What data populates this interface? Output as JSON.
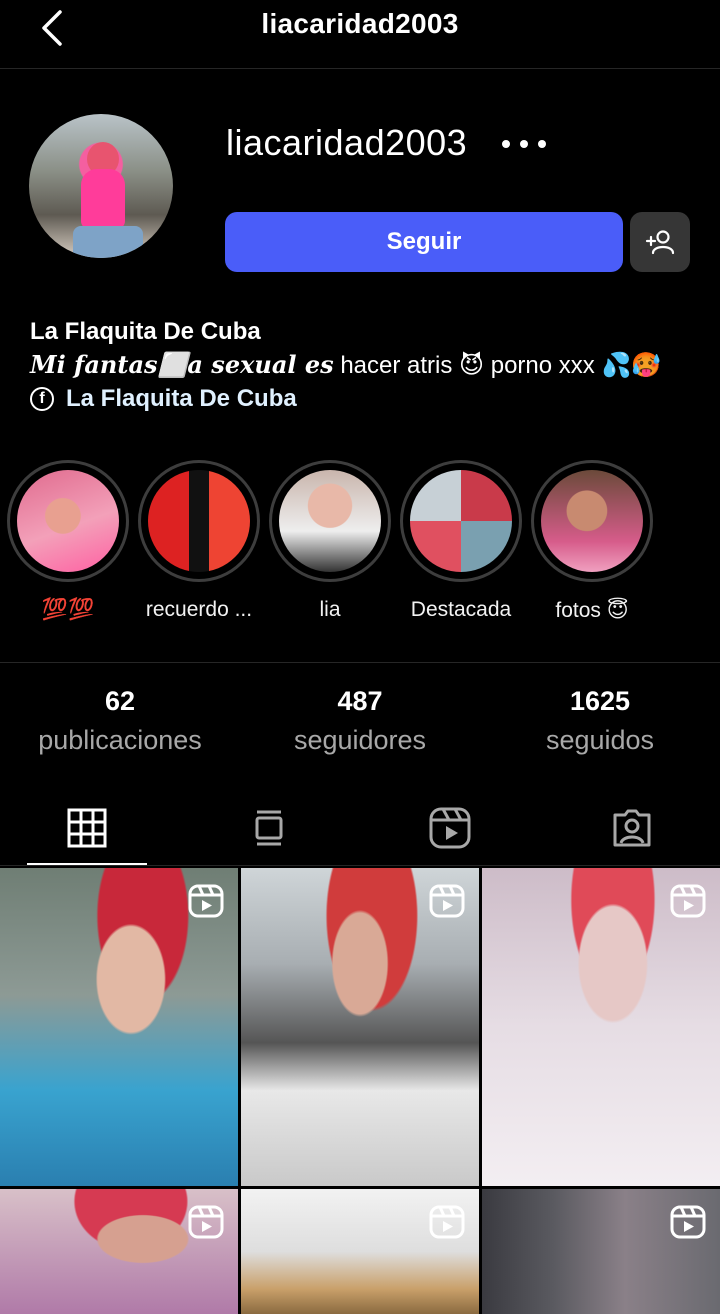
{
  "header": {
    "title": "liacaridad2003",
    "back_icon": "chevron-left-icon"
  },
  "profile": {
    "username": "liacaridad2003",
    "follow_label": "Seguir",
    "name": "La Flaquita De Cuba",
    "bio_italic": "Mi fantas⬜a sexual es",
    "bio_rest": " hacer atris 😈 porno xxx 💦🥵",
    "link_text": "La Flaquita De Cuba"
  },
  "highlights": [
    {
      "label": "💯💯"
    },
    {
      "label": "recuerdo ..."
    },
    {
      "label": "lia"
    },
    {
      "label": "Destacada"
    },
    {
      "label": "fotos 😇"
    }
  ],
  "stats": [
    {
      "value": "62",
      "label": "publicaciones"
    },
    {
      "value": "487",
      "label": "seguidores"
    },
    {
      "value": "1625",
      "label": "seguidos"
    }
  ],
  "tabs": [
    "grid-icon",
    "feed-icon",
    "reels-icon",
    "tagged-icon"
  ],
  "colors": {
    "accent": "#4a5df9",
    "background": "#000000",
    "secondary_text": "#a8a8a8"
  }
}
